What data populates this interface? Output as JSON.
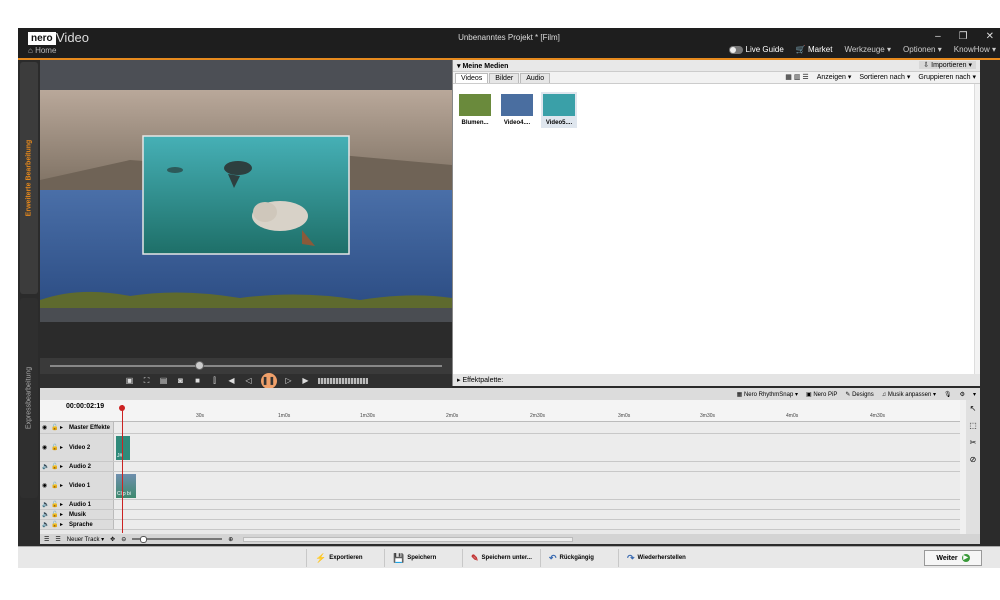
{
  "app": {
    "logo": "nero",
    "name": "Video",
    "home": "Home",
    "window_title": "Unbenanntes Projekt * [Film]",
    "menu": {
      "live_guide": "Live Guide",
      "market": "Market",
      "tools": "Werkzeuge",
      "options": "Optionen",
      "knowhow": "KnowHow"
    },
    "window_controls": {
      "minimize": "–",
      "restore": "❐",
      "close": "✕"
    }
  },
  "side_tabs": {
    "advanced": "Erweiterte Bearbeitung",
    "express": "Expressbearbeitung"
  },
  "media": {
    "header": "Meine Medien",
    "import": "Importieren",
    "tabs": [
      "Videos",
      "Bilder",
      "Audio"
    ],
    "active_tab": "Videos",
    "tools": {
      "view": "Anzeigen",
      "sort": "Sortieren nach",
      "group": "Gruppieren nach"
    },
    "items": [
      {
        "label": "Blumen...",
        "color": "#6a8a3c"
      },
      {
        "label": "Video4....",
        "color": "#4a6ea0"
      },
      {
        "label": "Video5....",
        "color": "#3aa0a8"
      }
    ],
    "selected_index": 2
  },
  "effects_palette": "Effektpalette:",
  "playback": {
    "position": 0.38
  },
  "timeline_toolbar": {
    "rhythm_snap": "Nero RhythmSnap",
    "pip": "Nero PiP",
    "designs": "Designs",
    "music_adjust": "Musik anpassen"
  },
  "timeline": {
    "timecode": "00:00:02:19",
    "ticks": [
      "30s",
      "1m0s",
      "1m30s",
      "2m0s",
      "2m30s",
      "3m0s",
      "3m30s",
      "4m0s",
      "4m30s"
    ],
    "tracks": [
      {
        "name": "Master Effekte"
      },
      {
        "name": "Video 2"
      },
      {
        "name": "Audio 2"
      },
      {
        "name": "Video 1"
      },
      {
        "name": "Audio 1"
      },
      {
        "name": "Musik"
      },
      {
        "name": "Sprache"
      }
    ],
    "clips": {
      "video2": "J#",
      "video1": "Clip bi"
    },
    "new_track": "Neuer Track"
  },
  "actions": {
    "export": "Exportieren",
    "save": "Speichern",
    "save_as": "Speichern unter...",
    "undo": "Rückgängig",
    "redo": "Wiederherstellen",
    "next": "Weiter"
  },
  "colors": {
    "accent": "#e68a1e",
    "playhead": "#cc2222",
    "clip": "#2f8a7a"
  }
}
